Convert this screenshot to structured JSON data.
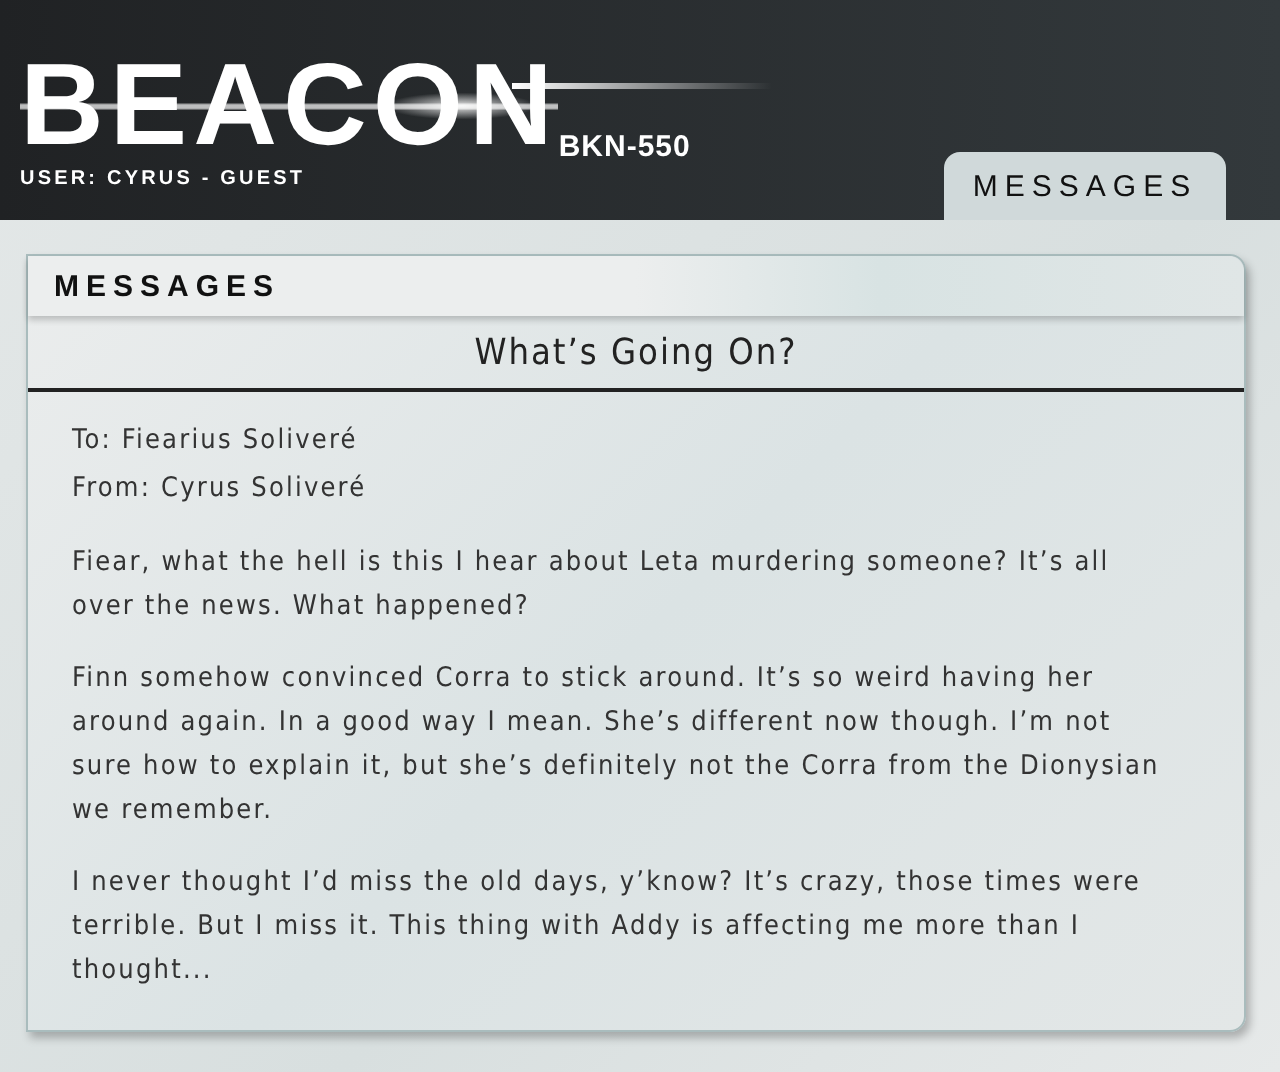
{
  "header": {
    "logo": "BEACON",
    "model": "BKN-550",
    "user": "USER: CYRUS - GUEST"
  },
  "tabs": [
    {
      "label": "MESSAGES",
      "selected": true
    }
  ],
  "panel": {
    "title": "MESSAGES",
    "subject": "What’s Going On?",
    "to": "To: Fiearius Soliveré",
    "from": "From: Cyrus Soliveré",
    "paragraphs": [
      "Fiear, what the hell is this I hear about Leta murdering someone? It’s all over the news. What happened?",
      "Finn somehow convinced Corra to stick around. It’s so weird having her around again. In a good way I mean. She’s different now though. I’m not sure how to explain it, but she’s definitely not the Corra from the Dionysian we remember.",
      "I never thought I’d miss the old days, y’know? It’s crazy, those times were terrible. But I miss it. This thing with Addy is affecting me more than I thought..."
    ]
  }
}
